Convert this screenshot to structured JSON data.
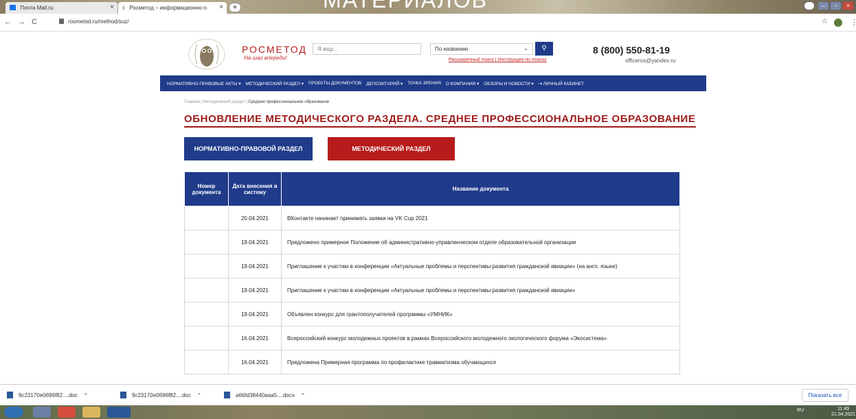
{
  "browser": {
    "tabs": [
      {
        "label": "Почта Mail.ru"
      },
      {
        "label": "Росметод – информационно-о"
      }
    ],
    "overlay_text": "МАТЕРИАЛОВ",
    "url": "rosmetod.ru/method/suz/"
  },
  "header": {
    "brand": "РОСМЕТОД",
    "slogan": "На шаг впереди!",
    "search_placeholder": "Я ищу...",
    "search_mode": "По названию",
    "search_links": "Расширенный поиск | Инструкция по поиску",
    "phone": "8 (800) 550-81-19",
    "email": "officeros@yandex.ru"
  },
  "menu": [
    "НОРМАТИВНО-ПРАВОВЫЕ АКТЫ ▾",
    "МЕТОДИЧЕСКИЙ РАЗДЕЛ ▾",
    "ПРОЕКТЫ ДОКУМЕНТОВ",
    "ДЕПОЗИТАРИЙ ▾",
    "ТОЧКА ЗРЕНИЯ",
    "О КОМПАНИИ ▾",
    "ОБЗОРЫ И НОВОСТИ ▾",
    "⇥ ЛИЧНЫЙ КАБИНЕТ"
  ],
  "breadcrumb": {
    "home": "Главная",
    "sep": "|",
    "section": "Методический раздел",
    "current": "Среднее профессиональное образование"
  },
  "title": "ОБНОВЛЕНИЕ МЕТОДИЧЕСКОГО РАЗДЕЛА. СРЕДНЕЕ ПРОФЕССИОНАЛЬНОЕ ОБРАЗОВАНИЕ",
  "buttons": {
    "normative": "НОРМАТИВНО-ПРАВОВОЙ РАЗДЕЛ",
    "methodical": "МЕТОДИЧЕСКИЙ РАЗДЕЛ"
  },
  "table": {
    "headers": [
      "Номер документа",
      "Дата внесения в систему",
      "Название документа"
    ],
    "rows": [
      {
        "num": "",
        "date": "20.04.2021",
        "name": "ВКонтакте начинает принимать заявки на VK Cup 2021"
      },
      {
        "num": "",
        "date": "19.04.2021",
        "name": "Предложено примерное Положение об административно-управленческом отделе образовательной организации"
      },
      {
        "num": "",
        "date": "19.04.2021",
        "name": "Приглашение к участию в конференции «Актуальные проблемы и перспективы развития гражданской авиации» (на англ. языке)"
      },
      {
        "num": "",
        "date": "19.04.2021",
        "name": "Приглашение к участию в конференции «Актуальные проблемы и перспективы развития гражданской авиации»"
      },
      {
        "num": "",
        "date": "19.04.2021",
        "name": "Объявлен конкурс для грантополучателей программы «УМНИК»"
      },
      {
        "num": "",
        "date": "16.04.2021",
        "name": "Всероссийский конкурс молодежных проектов в рамках Всероссийского молодежного экологического форума «Экосистема»"
      },
      {
        "num": "",
        "date": "16.04.2021",
        "name": "Предложена Примерная программа по профилактике травматизма обучающихся"
      }
    ]
  },
  "downloads": [
    {
      "name": "9c23170e0696f82....doc"
    },
    {
      "name": "9c23170e0696f82....doc"
    },
    {
      "name": "a66fd38440aaa5....docx"
    }
  ],
  "show_all": "Показать все",
  "tray": {
    "lang": "RU",
    "time": "11:49",
    "date": "21.04.2021"
  }
}
